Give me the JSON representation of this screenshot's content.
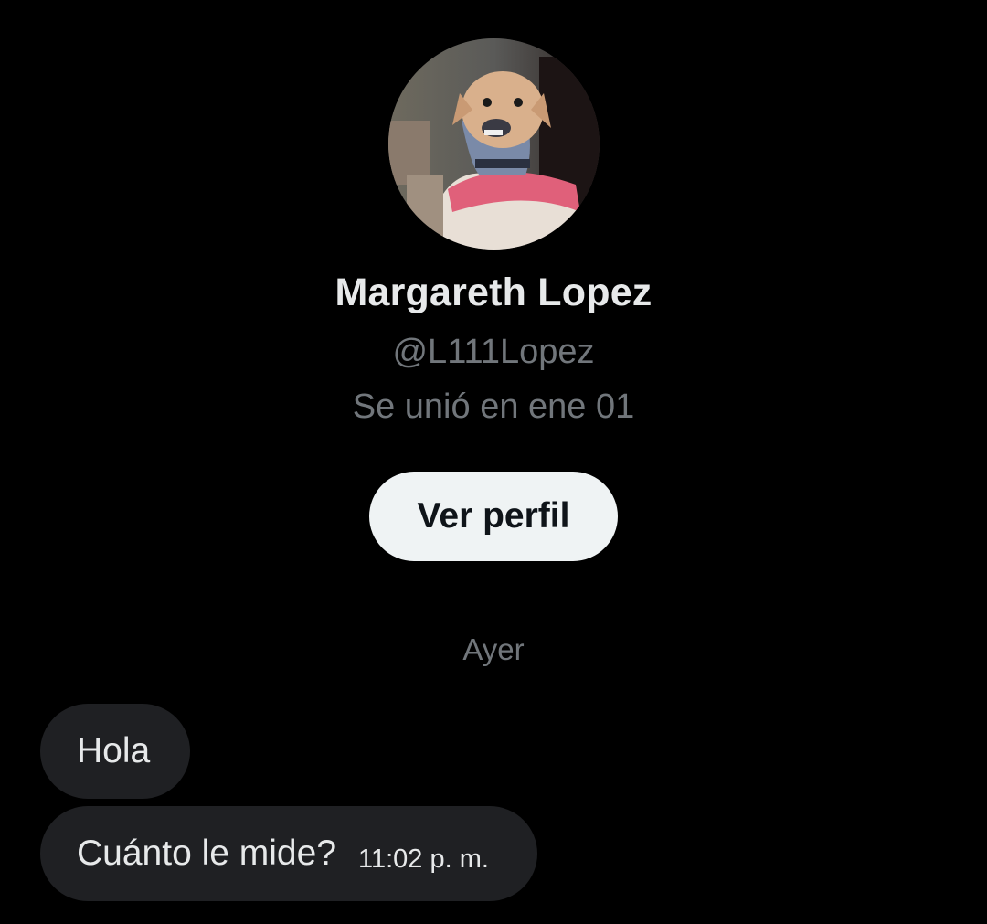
{
  "profile": {
    "display_name": "Margareth Lopez",
    "handle": "@L111Lopez",
    "joined": "Se unió en ene 01",
    "view_profile_label": "Ver perfil"
  },
  "conversation": {
    "date_divider": "Ayer",
    "messages": [
      {
        "text": "Hola",
        "time": ""
      },
      {
        "text": "Cuánto le mide?",
        "time": "11:02 p. m."
      }
    ]
  },
  "colors": {
    "background": "#000000",
    "primary_text": "#e7e9ea",
    "secondary_text": "#71767b",
    "bubble": "#1f2023",
    "button_bg": "#eff3f4",
    "button_text": "#0f1419"
  }
}
